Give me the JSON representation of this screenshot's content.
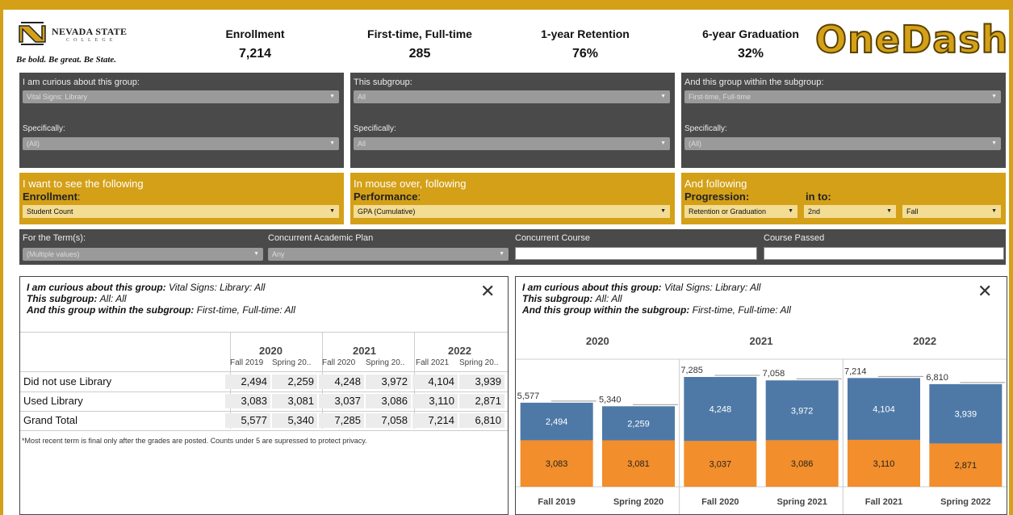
{
  "header": {
    "logo": {
      "name": "NEVADA STATE",
      "sub": "COLLEGE",
      "tagline": "Be bold. Be great. Be State."
    },
    "kpis": [
      {
        "label": "Enrollment",
        "value": "7,214"
      },
      {
        "label": "First-time, Full-time",
        "value": "285"
      },
      {
        "label": "1-year Retention",
        "value": "76%"
      },
      {
        "label": "6-year Graduation",
        "value": "32%"
      }
    ],
    "brand": "OneDash"
  },
  "filters": {
    "group": {
      "label": "I am curious about this group:",
      "value": "Vital Signs: Library",
      "spec_label": "Specifically:",
      "spec_value": "(All)"
    },
    "subgroup": {
      "label": "This subgroup:",
      "value": "All",
      "spec_label": "Specifically:",
      "spec_value": "All"
    },
    "within": {
      "label": "And this group within the subgroup:",
      "value": "First-time, Full-time",
      "spec_label": "Specifically:",
      "spec_value": "(All)"
    }
  },
  "measures": {
    "enrollment": {
      "line1": "I want to see the following",
      "line2": "Enrollment",
      "colon": ":",
      "value": "Student Count"
    },
    "performance": {
      "line1": "In mouse over, following",
      "line2": "Performance",
      "colon": ":",
      "value": "GPA (Cumulative)"
    },
    "progression": {
      "line1": "And following",
      "line2": "Progression:",
      "into": "in to:",
      "value": "Retention or Graduation",
      "value2": "2nd",
      "value3": "Fall"
    }
  },
  "terms": {
    "term_label": "For the Term(s):",
    "term_value": "(Multiple values)",
    "plan_label": "Concurrent Academic Plan",
    "plan_value": "Any",
    "course_label": "Concurrent Course",
    "passed_label": "Course Passed"
  },
  "summary": {
    "g_label": "I am curious about this group:",
    "g_value": "Vital Signs: Library: All",
    "s_label": "This subgroup:",
    "s_value": "All: All",
    "w_label": "And this group within the subgroup:",
    "w_value": "First-time, Full-time: All"
  },
  "table": {
    "years": [
      "2020",
      "2021",
      "2022"
    ],
    "terms": [
      "Fall 2019",
      "Spring 20..",
      "Fall 2020",
      "Spring 20..",
      "Fall 2021",
      "Spring 20.."
    ],
    "rows": [
      {
        "label": "Did not use Library",
        "values": [
          "2,494",
          "2,259",
          "4,248",
          "3,972",
          "4,104",
          "3,939"
        ]
      },
      {
        "label": "Used Library",
        "values": [
          "3,083",
          "3,081",
          "3,037",
          "3,086",
          "3,110",
          "2,871"
        ]
      },
      {
        "label": "Grand Total",
        "values": [
          "5,577",
          "5,340",
          "7,285",
          "7,058",
          "7,214",
          "6,810"
        ]
      }
    ],
    "note": "*Most recent term is final only after the grades are posted. Counts under 5 are supressed to protect privacy."
  },
  "chart_data": {
    "type": "bar",
    "stacked": true,
    "years": [
      "2020",
      "2021",
      "2022"
    ],
    "categories": [
      "Fall 2019",
      "Spring 2020",
      "Fall 2020",
      "Spring 2021",
      "Fall 2021",
      "Spring 2022"
    ],
    "series": [
      {
        "values": [
          3083,
          3081,
          3037,
          3086,
          3110,
          2871
        ],
        "color": "#f28e2b"
      },
      {
        "values": [
          2494,
          2259,
          4248,
          3972,
          4104,
          3939
        ],
        "color": "#4e79a7"
      }
    ],
    "totals": [
      5577,
      5340,
      7285,
      7058,
      7214,
      6810
    ],
    "labels_bottom": [
      "3,083",
      "3,081",
      "3,037",
      "3,086",
      "3,110",
      "2,871"
    ],
    "labels_top": [
      "2,494",
      "2,259",
      "4,248",
      "3,972",
      "4,104",
      "3,939"
    ],
    "labels_total": [
      "5,577",
      "5,340",
      "7,285",
      "7,058",
      "7,214",
      "6,810"
    ],
    "ylim": [
      0,
      7285
    ]
  }
}
